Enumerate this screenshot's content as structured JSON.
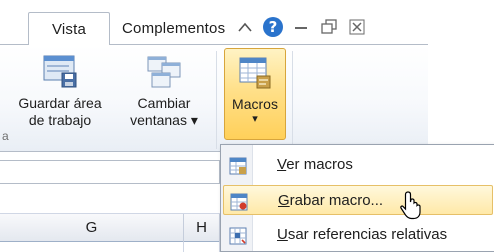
{
  "tabs": [
    {
      "label": "Vista"
    },
    {
      "label": "Complementos"
    }
  ],
  "window_controls": [
    "help-icon",
    "minimize-icon",
    "restore-icon",
    "close-icon"
  ],
  "ribbon": {
    "group_caption": "a",
    "guardar": {
      "line1": "Guardar área",
      "line2": "de trabajo"
    },
    "cambiar": {
      "line1": "Cambiar",
      "line2": "ventanas ▾"
    },
    "macros": {
      "label": "Macros",
      "arrow": "▾"
    }
  },
  "grid": {
    "columns": [
      "G",
      "H"
    ]
  },
  "macros_menu": {
    "items": [
      {
        "key": "V",
        "rest": "er macros"
      },
      {
        "key": "G",
        "rest": "rabar macro..."
      },
      {
        "key": "U",
        "rest": "sar referencias relativas"
      }
    ],
    "highlighted_index": 1
  },
  "colors": {
    "accent": "#ffd05a",
    "help_blue": "#2a73cc",
    "highlight": "#ffe9a8"
  }
}
